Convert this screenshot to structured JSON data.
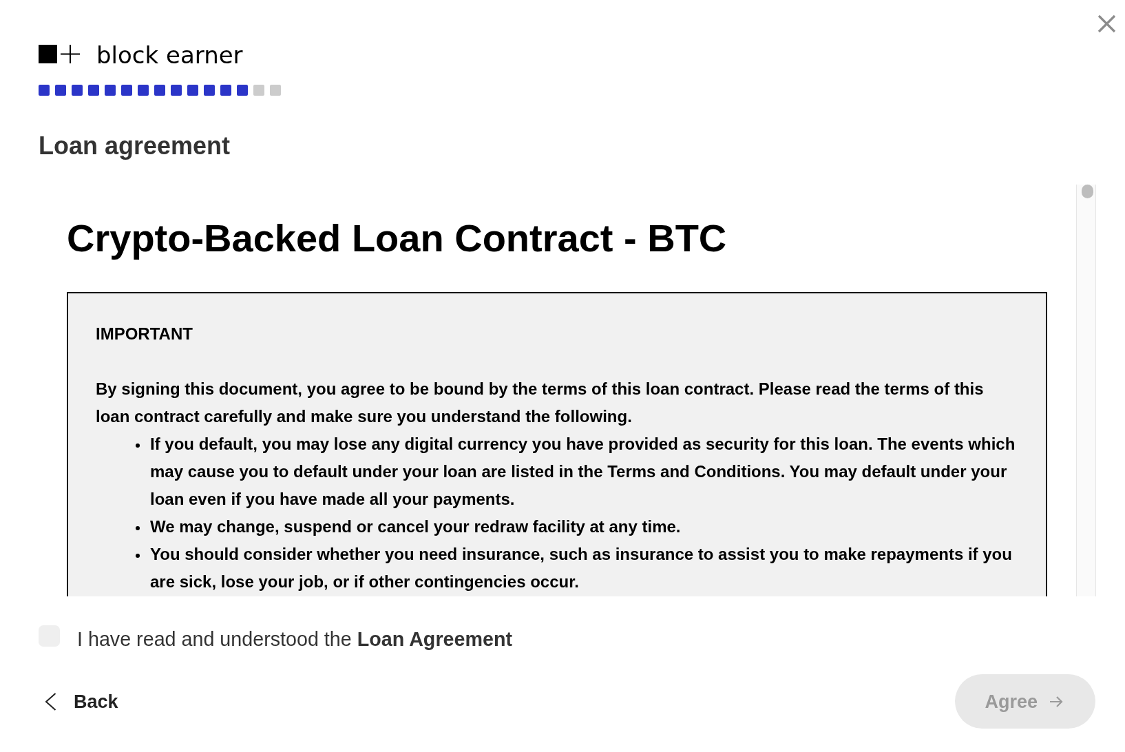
{
  "logo": {
    "text": "block earner"
  },
  "progress": {
    "steps": [
      {
        "done": true
      },
      {
        "done": true
      },
      {
        "done": true
      },
      {
        "done": true
      },
      {
        "done": true
      },
      {
        "done": true
      },
      {
        "done": true
      },
      {
        "done": true
      },
      {
        "done": true
      },
      {
        "done": true
      },
      {
        "done": true
      },
      {
        "done": true
      },
      {
        "done": true
      },
      {
        "done": false
      },
      {
        "done": false
      }
    ]
  },
  "page_title": "Loan agreement",
  "document": {
    "title": "Crypto-Backed Loan Contract - BTC",
    "notice": {
      "heading": "IMPORTANT",
      "paragraph": "By signing this document, you agree to be bound by the terms of this loan contract. Please read the terms of this loan contract carefully and make sure you understand the following.",
      "bullets": [
        "If you default, you may lose any digital currency you have provided as security for this loan. The events which may cause you to default under your loan are listed in the Terms and Conditions. You may default under your loan even if you have made all your payments.",
        "We may change, suspend or cancel your redraw facility at any time.",
        "You should consider whether you need insurance, such as insurance to assist you to make repayments if you are sick, lose your job, or if other contingencies occur."
      ]
    }
  },
  "consent": {
    "label": "I have read and understood the **Loan Agreement**",
    "checked": false
  },
  "back_button": {
    "label": "Back"
  },
  "agree_button": {
    "label": "Agree",
    "disabled": true
  }
}
